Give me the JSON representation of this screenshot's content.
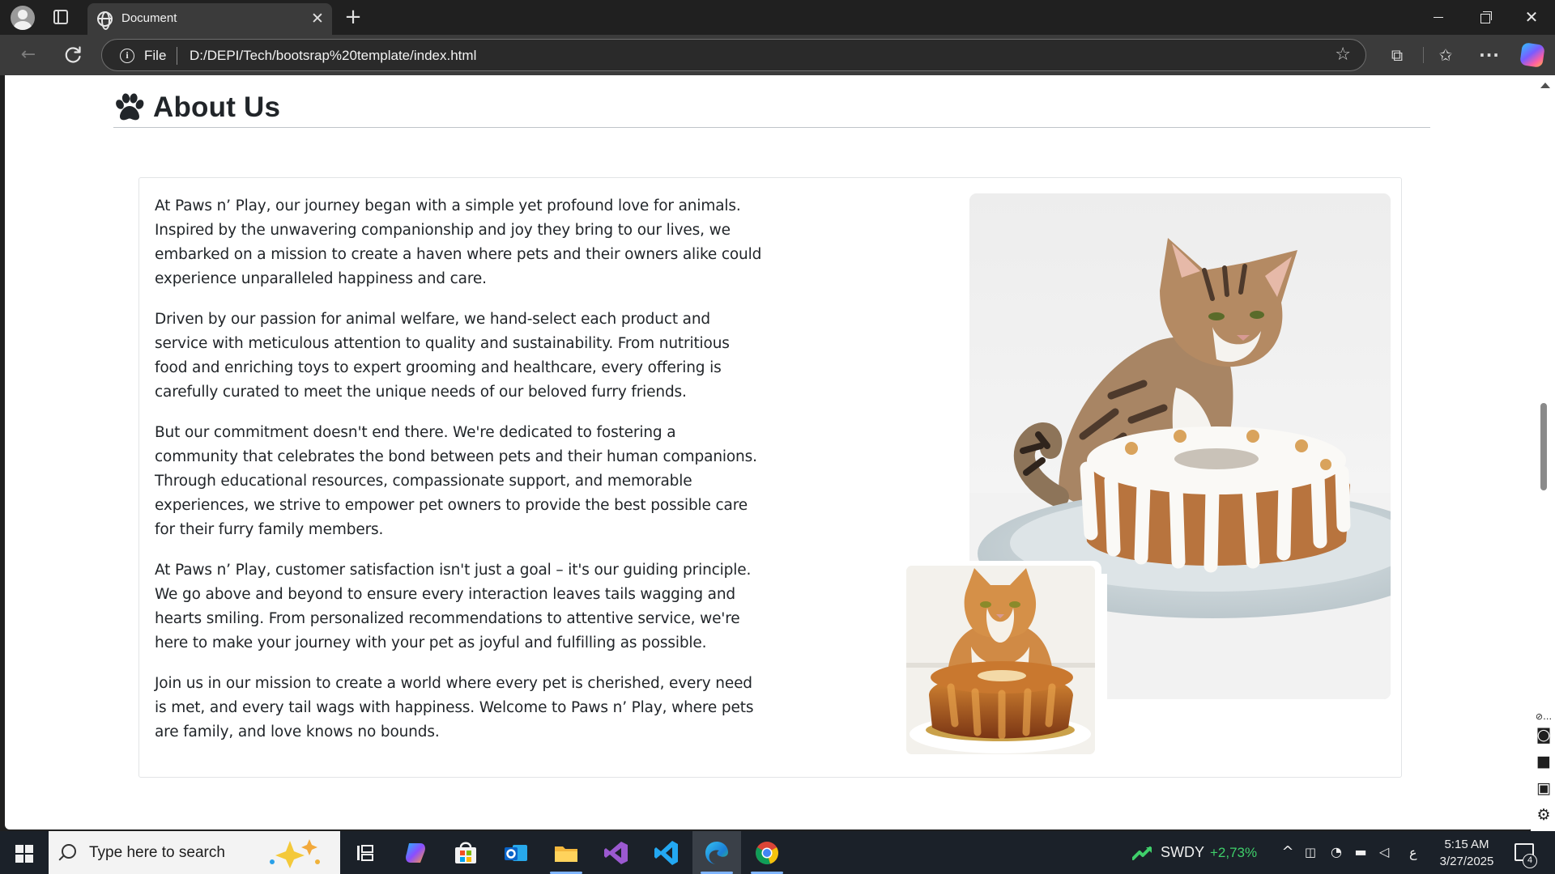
{
  "browser": {
    "tab_title": "Document",
    "address_prefix": "File",
    "url": "D:/DEPI/Tech/bootsrap%20template/index.html",
    "icons": [
      "profile-icon",
      "tab-actions-icon",
      "globe-icon",
      "close-icon",
      "plus-icon",
      "back-icon",
      "reload-icon",
      "info-icon",
      "star-icon",
      "extensions-icon",
      "favorites-icon",
      "more-icon",
      "copilot-icon"
    ]
  },
  "page": {
    "section_title": "About Us",
    "title_icon": "paw-icon",
    "paragraphs": [
      "At Paws n’ Play, our journey began with a simple yet profound love for animals. Inspired by the unwavering companionship and joy they bring to our lives, we embarked on a mission to create a haven where pets and their owners alike could experience unparalleled happiness and care.",
      "Driven by our passion for animal welfare, we hand-select each product and service with meticulous attention to quality and sustainability. From nutritious food and enriching toys to expert grooming and healthcare, every offering is carefully curated to meet the unique needs of our beloved furry friends.",
      "But our commitment doesn't end there. We're dedicated to fostering a community that celebrates the bond between pets and their human companions. Through educational resources, compassionate support, and memorable experiences, we strive to empower pet owners to provide the best possible care for their furry family members.",
      "At Paws n’ Play, customer satisfaction isn't just a goal – it's our guiding principle. We go above and beyond to ensure every interaction leaves tails wagging and hearts smiling. From personalized recommendations to attentive service, we're here to make your journey with your pet as joyful and fulfilling as possible.",
      "Join us in our mission to create a world where every pet is cherished, every need is met, and every tail wags with happiness. Welcome to Paws n’ Play, where pets are family, and love knows no bounds."
    ],
    "images": [
      "tabby cat sniffing an iced bundt cake on a plate",
      "orange and white cat behind a glazed bundt cake"
    ]
  },
  "taskbar": {
    "search_placeholder": "Type here to search",
    "stock_ticker": "SWDY",
    "stock_change": "+2,73%",
    "input_indicator": "ع",
    "time": "5:15 AM",
    "date": "3/27/2025",
    "notification_count": "4",
    "colors": {
      "stock_up": "#3fcf6a",
      "active_indicator": "#7fb4ff"
    }
  }
}
